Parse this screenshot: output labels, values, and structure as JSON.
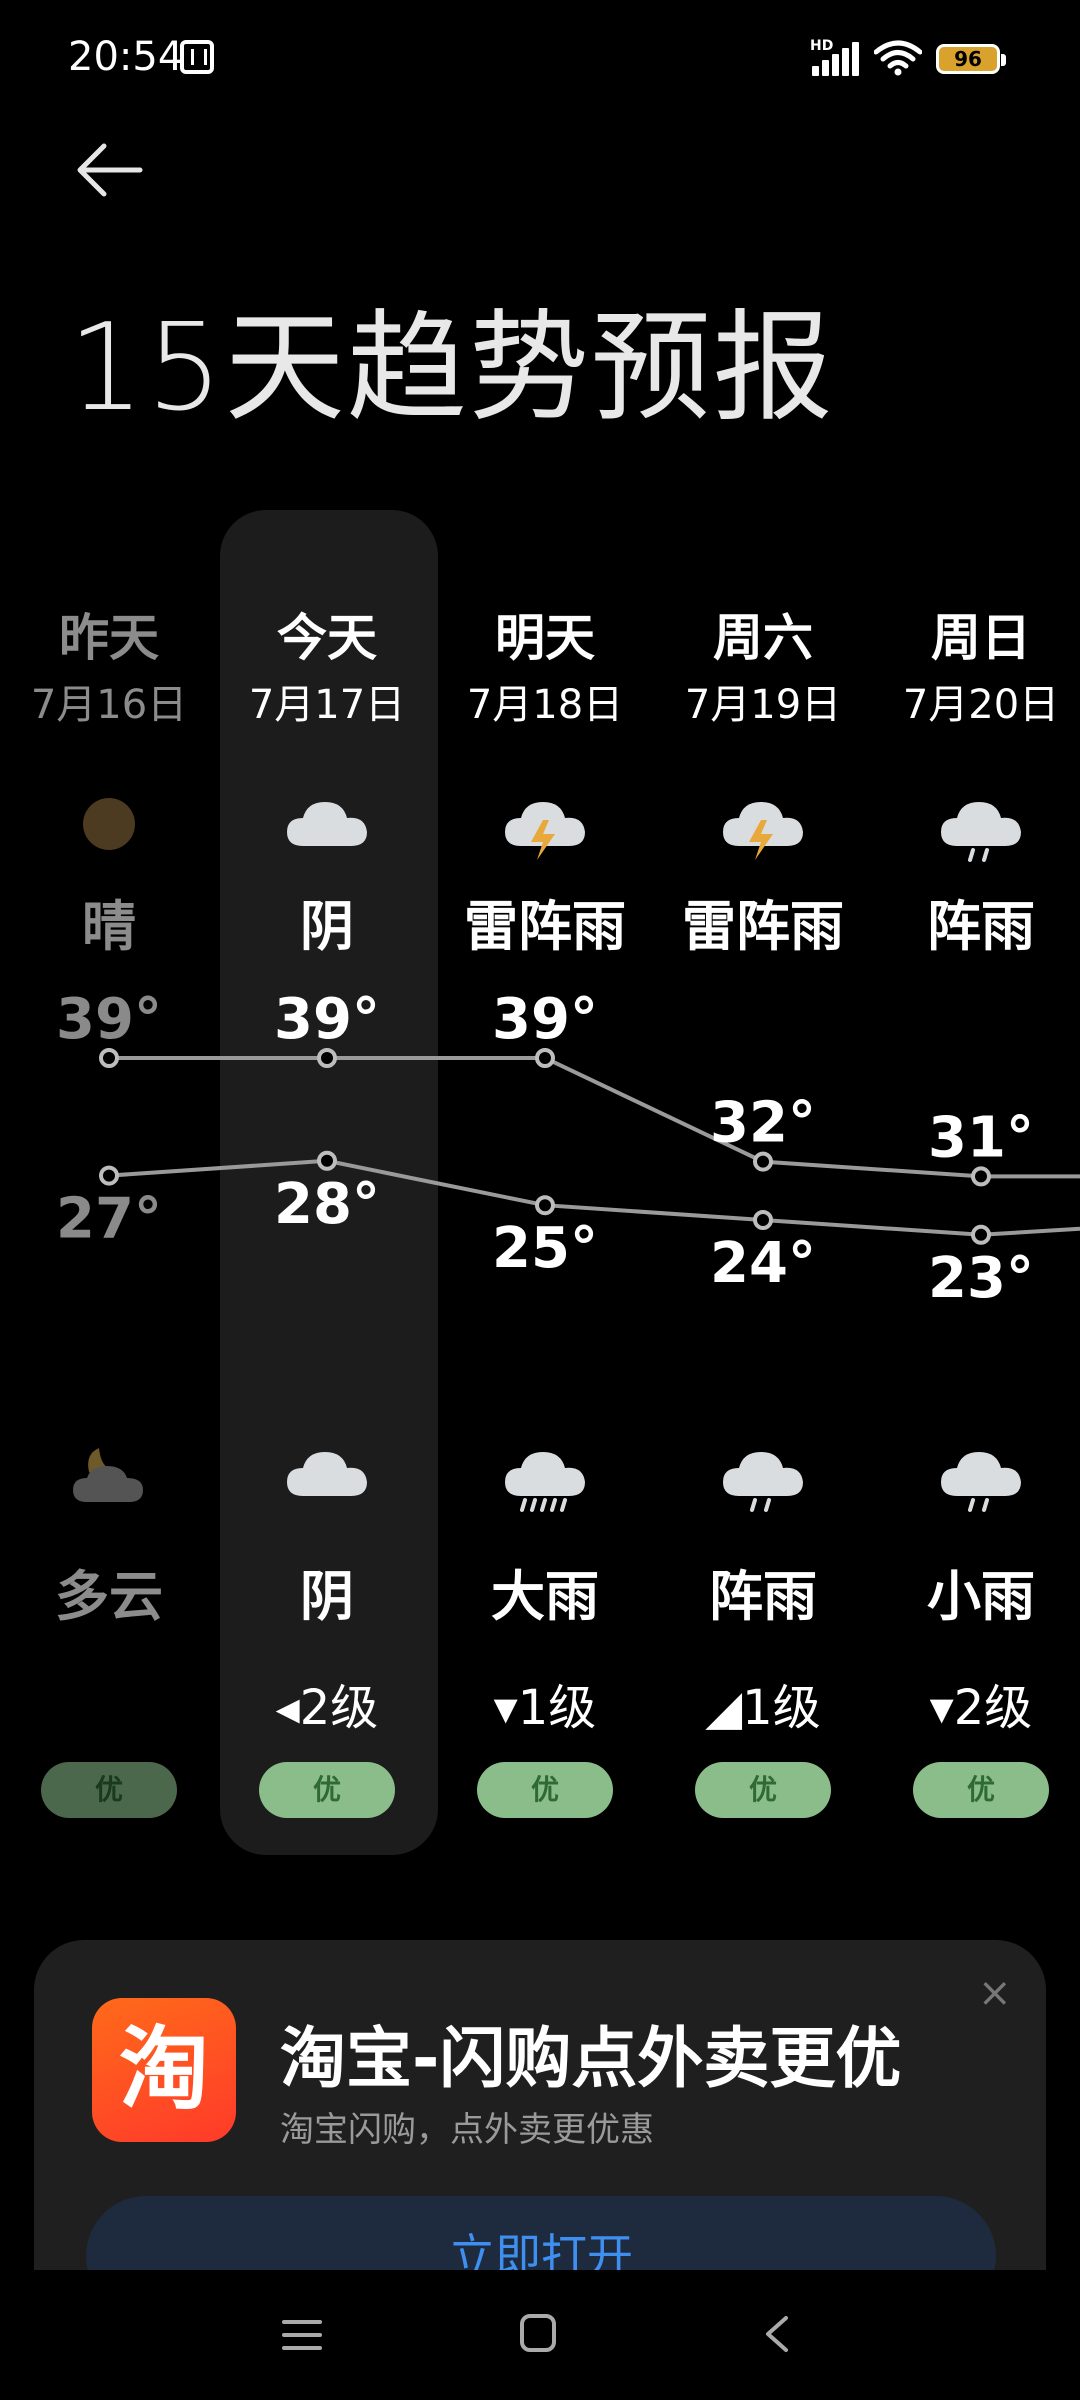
{
  "status_bar": {
    "time": "20:54",
    "network": "HD",
    "battery": "96"
  },
  "header": {
    "title": "15天趋势预报"
  },
  "days": [
    {
      "name": "昨天",
      "date": "7月16日",
      "day_icon": "sun-icon",
      "day_condition": "晴",
      "high": "39°",
      "low": "27°",
      "night_icon": "partly-cloudy-night-icon",
      "night_condition": "多云",
      "wind": "",
      "aqi": "优",
      "past": true
    },
    {
      "name": "今天",
      "date": "7月17日",
      "day_icon": "overcast-icon",
      "day_condition": "阴",
      "high": "39°",
      "low": "28°",
      "night_icon": "overcast-icon",
      "night_condition": "阴",
      "wind": "◂2级",
      "aqi": "优",
      "past": false
    },
    {
      "name": "明天",
      "date": "7月18日",
      "day_icon": "thunderstorm-icon",
      "day_condition": "雷阵雨",
      "high": "39°",
      "low": "25°",
      "night_icon": "heavy-rain-icon",
      "night_condition": "大雨",
      "wind": "▾1级",
      "aqi": "优",
      "past": false
    },
    {
      "name": "周六",
      "date": "7月19日",
      "day_icon": "thunderstorm-icon",
      "day_condition": "雷阵雨",
      "high": "32°",
      "low": "24°",
      "night_icon": "shower-icon",
      "night_condition": "阵雨",
      "wind": "◢1级",
      "aqi": "优",
      "past": false
    },
    {
      "name": "周日",
      "date": "7月20日",
      "day_icon": "shower-icon",
      "day_condition": "阵雨",
      "high": "31°",
      "low": "23°",
      "night_icon": "light-rain-icon",
      "night_condition": "小雨",
      "wind": "▾2级",
      "aqi": "优",
      "past": false
    }
  ],
  "chart_data": {
    "type": "line",
    "categories": [
      "7月16日",
      "7月17日",
      "7月18日",
      "7月19日",
      "7月20日"
    ],
    "series": [
      {
        "name": "high",
        "values": [
          39,
          39,
          39,
          32,
          31
        ]
      },
      {
        "name": "low",
        "values": [
          27,
          28,
          25,
          24,
          23
        ]
      }
    ],
    "ylim": [
      20,
      42
    ],
    "grid": false
  },
  "ad": {
    "app_logo_text": "淘",
    "title": "淘宝-闪购点外卖更优",
    "subtitle": "淘宝闪购，点外卖更优惠",
    "button": "立即打开",
    "close": "×"
  },
  "colors": {
    "background": "#000000",
    "today_column": "#1c1c1c",
    "aqi_good": "#8bbd8b",
    "line": "#9a9a9a",
    "ad_button_text": "#3f8ff0"
  }
}
